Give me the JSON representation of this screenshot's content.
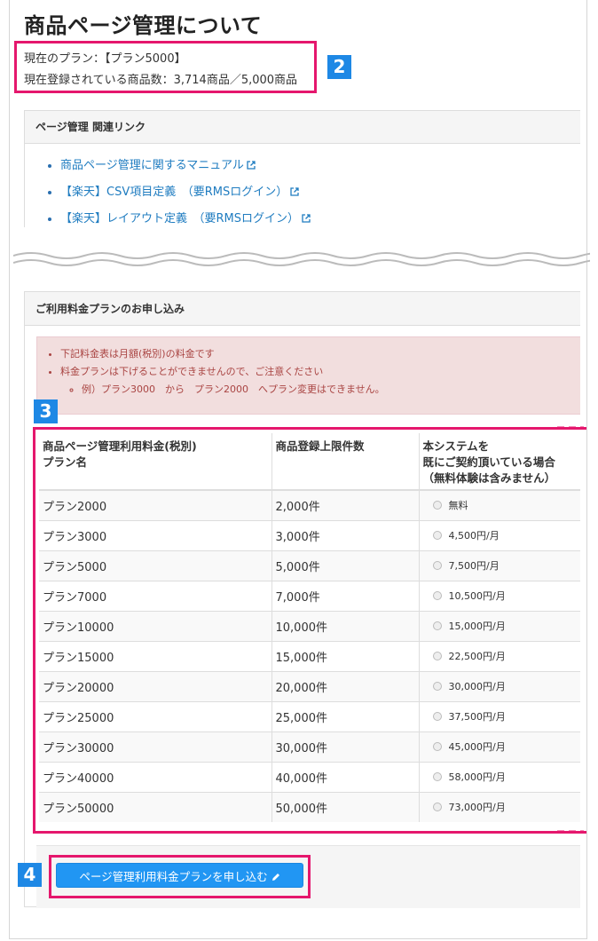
{
  "page": {
    "title": "商品ページ管理について",
    "current_plan": "現在のプラン：【プラン5000】",
    "registered_count": "現在登録されている商品数：3,714商品／5,000商品"
  },
  "markers": [
    "2",
    "3",
    "4"
  ],
  "related_links": {
    "heading": "ページ管理 関連リンク",
    "items": [
      "商品ページ管理に関するマニュアル",
      "【楽天】CSV項目定義　（要RMSログイン）",
      "【楽天】レイアウト定義　（要RMSログイン）"
    ]
  },
  "plan_apply": {
    "heading": "ご利用料金プランのお申し込み",
    "notes": [
      "下記料金表は月額(税別)の料金です",
      "料金プランは下げることができませんので、ご注意ください"
    ],
    "sub_note": "例）プラン3000　から　プラン2000　へプラン変更はできません。",
    "table": {
      "headers": [
        [
          "商品ページ管理利用料金(税別)",
          "プラン名"
        ],
        [
          "商品登録上限件数"
        ],
        [
          "本システムを",
          "既にご契約頂いている場合",
          "（無料体験は含みません）"
        ]
      ],
      "rows": [
        [
          "プラン2000",
          "2,000件",
          "無料"
        ],
        [
          "プラン3000",
          "3,000件",
          "4,500円/月"
        ],
        [
          "プラン5000",
          "5,000件",
          "7,500円/月"
        ],
        [
          "プラン7000",
          "7,000件",
          "10,500円/月"
        ],
        [
          "プラン10000",
          "10,000件",
          "15,000円/月"
        ],
        [
          "プラン15000",
          "15,000件",
          "22,500円/月"
        ],
        [
          "プラン20000",
          "20,000件",
          "30,000円/月"
        ],
        [
          "プラン25000",
          "25,000件",
          "37,500円/月"
        ],
        [
          "プラン30000",
          "30,000件",
          "45,000円/月"
        ],
        [
          "プラン40000",
          "40,000件",
          "58,000円/月"
        ],
        [
          "プラン50000",
          "50,000件",
          "73,000円/月"
        ]
      ]
    },
    "button_label": "ページ管理利用料金プランを申し込む"
  },
  "icons": {
    "link": "external-link-icon",
    "button": "pencil-icon",
    "rows": "radio-icon"
  },
  "colors": {
    "highlight": "#e5176d",
    "marker": "#1e88e5",
    "link": "#1f7cc0",
    "alert_bg": "#f2dede",
    "alert_text": "#a94442",
    "button": "#2196f3"
  }
}
